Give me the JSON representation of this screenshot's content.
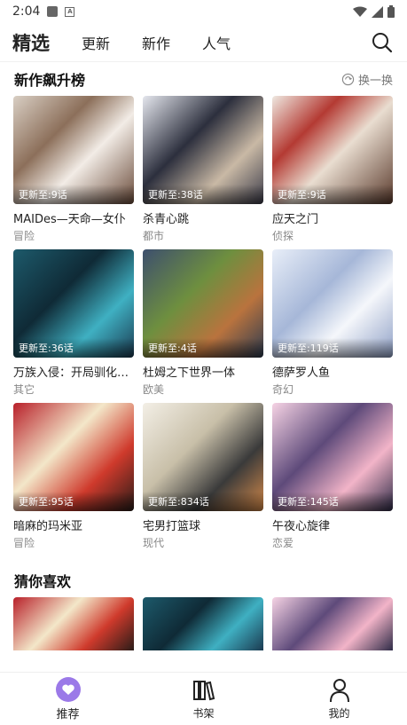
{
  "status_bar": {
    "time": "2:04"
  },
  "top_nav": {
    "tabs": [
      "精选",
      "更新",
      "新作",
      "人气"
    ],
    "active_index": 0
  },
  "section_new": {
    "title": "新作飙升榜",
    "refresh_label": "换一换",
    "cards": [
      {
        "update": "更新至:9话",
        "title": "MAIDes—天命—女仆",
        "genre": "冒险"
      },
      {
        "update": "更新至:38话",
        "title": "杀青心跳",
        "genre": "都市"
      },
      {
        "update": "更新至:9话",
        "title": "应天之门",
        "genre": "侦探"
      },
      {
        "update": "更新至:36话",
        "title": "万族入侵：开局驯化…",
        "genre": "其它"
      },
      {
        "update": "更新至:4话",
        "title": "杜姆之下世界一体",
        "genre": "欧美"
      },
      {
        "update": "更新至:119话",
        "title": "德萨罗人鱼",
        "genre": "奇幻"
      },
      {
        "update": "更新至:95话",
        "title": "暗麻的玛米亚",
        "genre": "冒险"
      },
      {
        "update": "更新至:834话",
        "title": "宅男打篮球",
        "genre": "现代"
      },
      {
        "update": "更新至:145话",
        "title": "午夜心旋律",
        "genre": "恋爱"
      }
    ]
  },
  "section_guess": {
    "title": "猜你喜欢"
  },
  "bottom_nav": {
    "items": [
      {
        "label": "推荐",
        "icon": "heart-icon"
      },
      {
        "label": "书架",
        "icon": "bookshelf-icon"
      },
      {
        "label": "我的",
        "icon": "user-icon"
      }
    ],
    "active_index": 0,
    "accent": "#9b79e8"
  }
}
